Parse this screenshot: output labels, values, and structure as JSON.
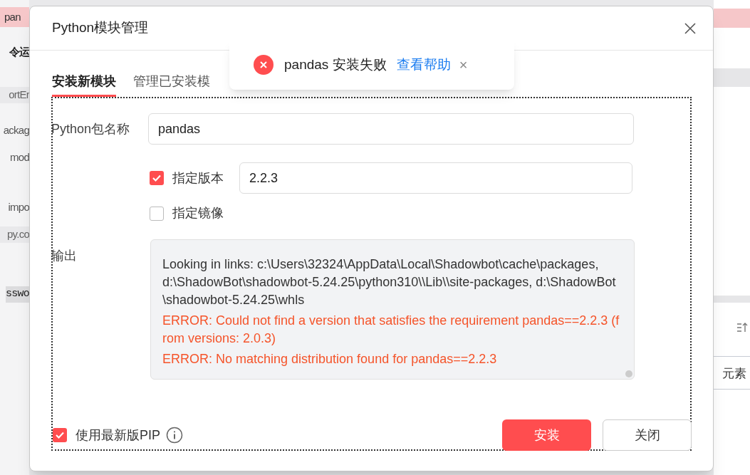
{
  "background": {
    "left_texts": [
      {
        "text": "pan",
        "kind": "highlight"
      },
      {
        "text": "令运",
        "kind": "heading"
      },
      {
        "text": "ortEr",
        "kind": "gray"
      },
      {
        "text": "ackag",
        "kind": "plain"
      },
      {
        "text": "mod",
        "kind": "plain"
      },
      {
        "text": "impo",
        "kind": "plain"
      },
      {
        "text": "py.co",
        "kind": "gray"
      },
      {
        "text": "sswo",
        "kind": "mono"
      }
    ],
    "right_text": "元素"
  },
  "dialog": {
    "title": "Python模块管理",
    "tabs": [
      {
        "label": "安装新模块",
        "selected": true
      },
      {
        "label": "管理已安装模",
        "selected": false
      }
    ],
    "package_label": "Python包名称",
    "package_value": "pandas",
    "version": {
      "label": "指定版本",
      "checked": true,
      "value": "2.2.3"
    },
    "mirror": {
      "label": "指定镜像",
      "checked": false
    },
    "output_label": "输出",
    "output_lines": [
      {
        "text": "Looking in links: c:\\Users\\32324\\AppData\\Local\\Shadowbot\\cache\\packages, d:\\ShadowBot\\shadowbot-5.24.25\\python310\\\\Lib\\\\site-packages, d:\\ShadowBot\\shadowbot-5.24.25\\whls",
        "kind": "info"
      },
      {
        "text": "ERROR: Could not find a version that satisfies the requirement pandas==2.2.3 (from versions: 2.0.3)",
        "kind": "error"
      },
      {
        "text": "ERROR: No matching distribution found for pandas==2.2.3",
        "kind": "error"
      }
    ],
    "latest_pip": {
      "label": "使用最新版PIP",
      "checked": true
    },
    "buttons": [
      {
        "label": "安装",
        "kind": "primary"
      },
      {
        "label": "关闭",
        "kind": "secondary"
      }
    ]
  },
  "toast": {
    "message": "pandas 安装失败",
    "link": "查看帮助",
    "close": "×"
  }
}
